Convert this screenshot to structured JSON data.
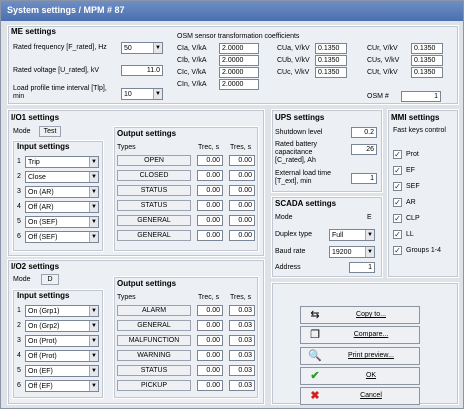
{
  "title": "System settings / MPM # 87",
  "me": {
    "header": "ME settings",
    "freq_label": "Rated frequency [F_rated], Hz",
    "freq_value": "50",
    "volt_label": "Rated voltage [U_rated], kV",
    "volt_value": "11.0",
    "load_label": "Load profile time interval [Tlp], min",
    "load_value": "10",
    "osm_header": "OSM sensor transformation coefficients",
    "c1": [
      {
        "l": "CIa, V/kA",
        "v": "2.0000"
      },
      {
        "l": "CIb, V/kA",
        "v": "2.0000"
      },
      {
        "l": "CIc, V/kA",
        "v": "2.0000"
      },
      {
        "l": "CIn, V/kA",
        "v": "2.0000"
      }
    ],
    "c2": [
      {
        "l": "CUa, V/kV",
        "v": "0.1350"
      },
      {
        "l": "CUb, V/kV",
        "v": "0.1350"
      },
      {
        "l": "CUc, V/kV",
        "v": "0.1350"
      }
    ],
    "c3": [
      {
        "l": "CUr, V/kV",
        "v": "0.1350"
      },
      {
        "l": "CUs, V/kV",
        "v": "0.1350"
      },
      {
        "l": "CUt, V/kV",
        "v": "0.1350"
      }
    ],
    "osm_no_label": "OSM #",
    "osm_no_value": "1"
  },
  "io1": {
    "header": "I/O1 settings",
    "mode_label": "Mode",
    "mode_value": "Test",
    "input_header": "Input settings",
    "inputs": [
      "Trip",
      "Close",
      "On (AR)",
      "Off (AR)",
      "On (SEF)",
      "Off (SEF)"
    ],
    "output_header": "Output settings",
    "col_types": "Types",
    "col_trec": "Trec, s",
    "col_tres": "Tres, s",
    "outputs": [
      {
        "t": "OPEN",
        "a": "0.00",
        "b": "0.00"
      },
      {
        "t": "CLOSED",
        "a": "0.00",
        "b": "0.00"
      },
      {
        "t": "STATUS",
        "a": "0.00",
        "b": "0.00"
      },
      {
        "t": "STATUS",
        "a": "0.00",
        "b": "0.00"
      },
      {
        "t": "GENERAL",
        "a": "0.00",
        "b": "0.00"
      },
      {
        "t": "GENERAL",
        "a": "0.00",
        "b": "0.00"
      }
    ]
  },
  "io2": {
    "header": "I/O2 settings",
    "mode_label": "Mode",
    "mode_value": "D",
    "input_header": "Input settings",
    "inputs": [
      "On (Grp1)",
      "On (Grp2)",
      "On (Prot)",
      "Off (Prot)",
      "On (EF)",
      "Off (EF)"
    ],
    "output_header": "Output settings",
    "col_types": "Types",
    "col_trec": "Trec, s",
    "col_tres": "Tres, s",
    "outputs": [
      {
        "t": "ALARM",
        "a": "0.00",
        "b": "0.03"
      },
      {
        "t": "GENERAL",
        "a": "0.00",
        "b": "0.03"
      },
      {
        "t": "MALFUNCTION",
        "a": "0.00",
        "b": "0.03"
      },
      {
        "t": "WARNING",
        "a": "0.00",
        "b": "0.03"
      },
      {
        "t": "STATUS",
        "a": "0.00",
        "b": "0.03"
      },
      {
        "t": "PICKUP",
        "a": "0.00",
        "b": "0.03"
      }
    ]
  },
  "ups": {
    "header": "UPS settings",
    "shutdown_label": "Shutdown level",
    "shutdown_value": "0.2",
    "cap_label": "Rated battery capacitance [C_rated], Ah",
    "cap_value": "26",
    "ext_label": "External load time [T_ext], min",
    "ext_value": "1"
  },
  "scada": {
    "header": "SCADA settings",
    "mode_label": "Mode",
    "mode_value": "E",
    "duplex_label": "Duplex type",
    "duplex_value": "Full",
    "baud_label": "Baud rate",
    "baud_value": "19200",
    "addr_label": "Address",
    "addr_value": "1"
  },
  "mmi": {
    "header": "MMI settings",
    "sub": "Fast keys control",
    "items": [
      "Prot",
      "EF",
      "SEF",
      "AR",
      "CLP",
      "LL",
      "Groups 1-4"
    ]
  },
  "buttons": {
    "copy": "Copy to...",
    "compare": "Compare...",
    "preview": "Print preview...",
    "ok": "OK",
    "cancel": "Cancel"
  }
}
